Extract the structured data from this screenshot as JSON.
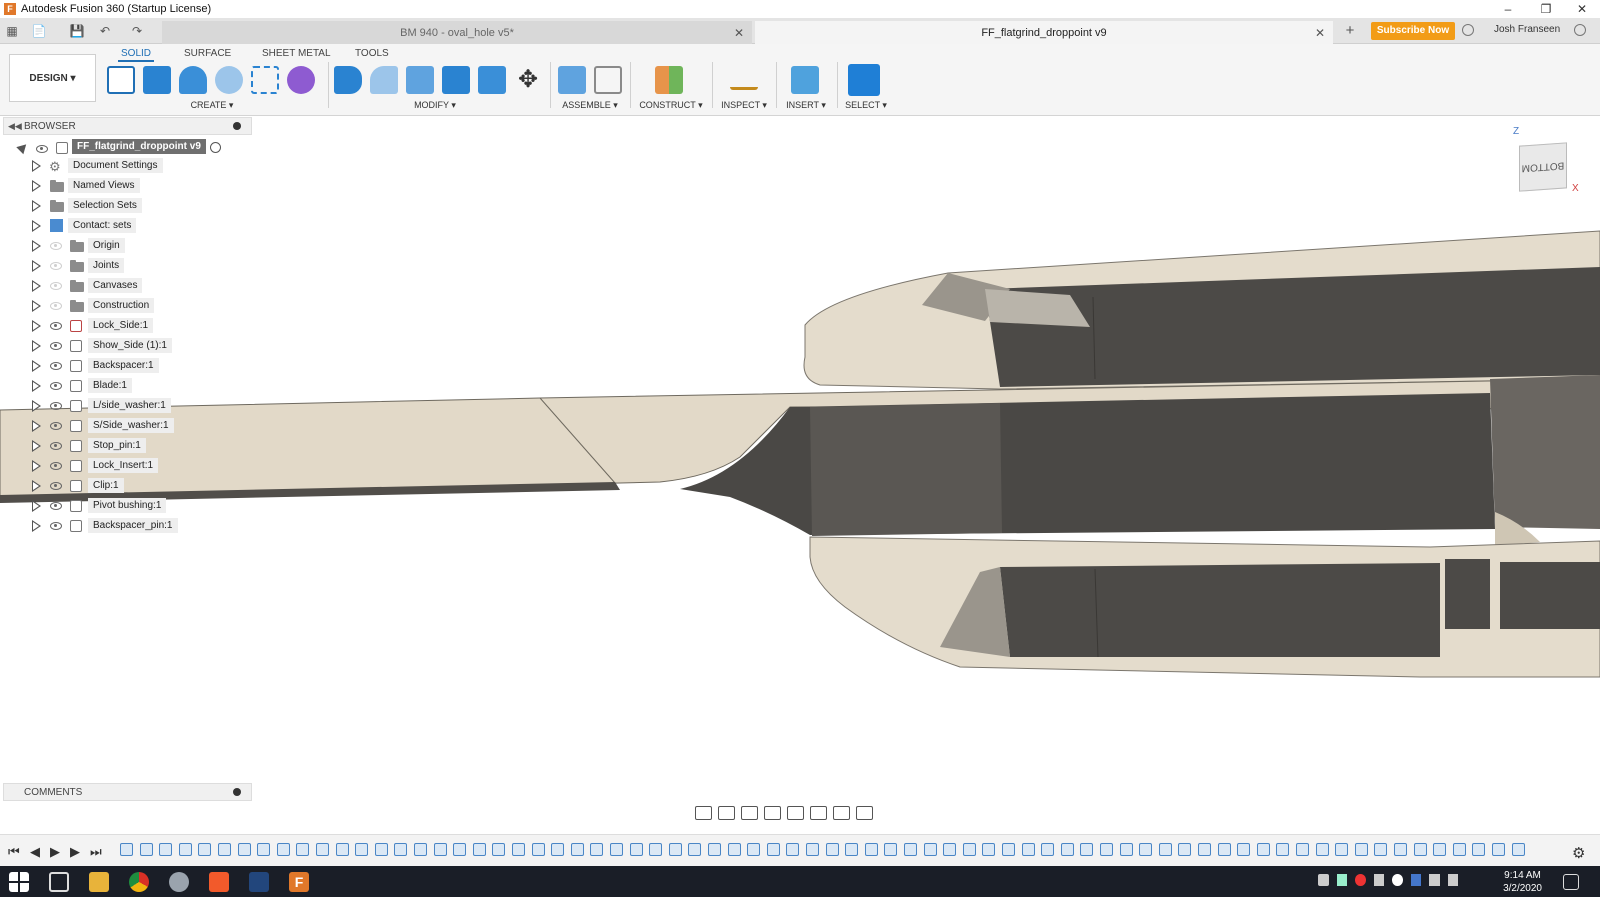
{
  "window": {
    "title": "Autodesk Fusion 360 (Startup License)",
    "minimize": "–",
    "restore": "❐",
    "close": "✕"
  },
  "tabs": [
    {
      "label": "BM 940 - oval_hole v5*",
      "active": false
    },
    {
      "label": "FF_flatgrind_droppoint v9",
      "active": true
    }
  ],
  "tab_close": "✕",
  "new_tab": "+",
  "subscribe": "Subscribe Now",
  "user": "Josh Franseen",
  "workspace": "DESIGN ▾",
  "ribbon_tabs": [
    "SOLID",
    "SURFACE",
    "SHEET METAL",
    "TOOLS"
  ],
  "groups": [
    "CREATE ▾",
    "MODIFY ▾",
    "ASSEMBLE ▾",
    "CONSTRUCT ▾",
    "INSPECT ▾",
    "INSERT ▾",
    "SELECT ▾"
  ],
  "browser": {
    "title": "BROWSER",
    "root": "FF_flatgrind_droppoint v9",
    "items": [
      "Document Settings",
      "Named Views",
      "Selection Sets",
      "Contact: sets",
      "Origin",
      "Joints",
      "Canvases",
      "Construction",
      "Lock_Side:1",
      "Show_Side (1):1",
      "Backspacer:1",
      "Blade:1",
      "L/side_washer:1",
      "S/Side_washer:1",
      "Stop_pin:1",
      "Lock_Insert:1",
      "Clip:1",
      "Pivot bushing:1",
      "Backspacer_pin:1"
    ]
  },
  "comments": "COMMENTS",
  "viewcube": {
    "face": "BOTTOM",
    "z": "Z",
    "x": "X"
  },
  "taskbar": {
    "time": "9:14 AM",
    "date": "3/2/2020"
  },
  "colors": {
    "accent": "#1f6fb5",
    "subscribe": "#f29c17",
    "model_light": "#e4dccc",
    "model_dark": "#4c4a47",
    "taskbar": "#1a1e27"
  }
}
